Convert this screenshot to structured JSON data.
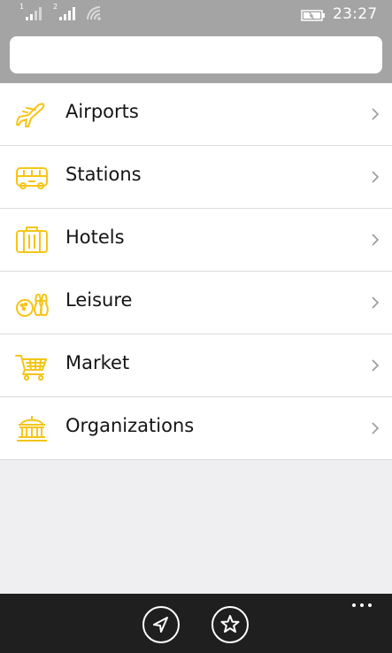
{
  "status": {
    "sim1": "1",
    "sim2": "2",
    "time": "23:27"
  },
  "search": {
    "value": "",
    "placeholder": ""
  },
  "categories": [
    {
      "label": "Airports",
      "icon": "airplane-icon"
    },
    {
      "label": "Stations",
      "icon": "bus-icon"
    },
    {
      "label": "Hotels",
      "icon": "suitcase-icon"
    },
    {
      "label": "Leisure",
      "icon": "bowling-icon"
    },
    {
      "label": "Market",
      "icon": "shopping-cart-icon"
    },
    {
      "label": "Organizations",
      "icon": "government-building-icon"
    }
  ],
  "appbar": {
    "buttons": [
      "navigation-arrow-icon",
      "star-icon"
    ],
    "more_icon": "ellipsis-icon"
  },
  "colors": {
    "accent": "#f5c518",
    "header": "#a4a4a4",
    "appbar": "#1f1f1f",
    "background": "#efeff1"
  }
}
